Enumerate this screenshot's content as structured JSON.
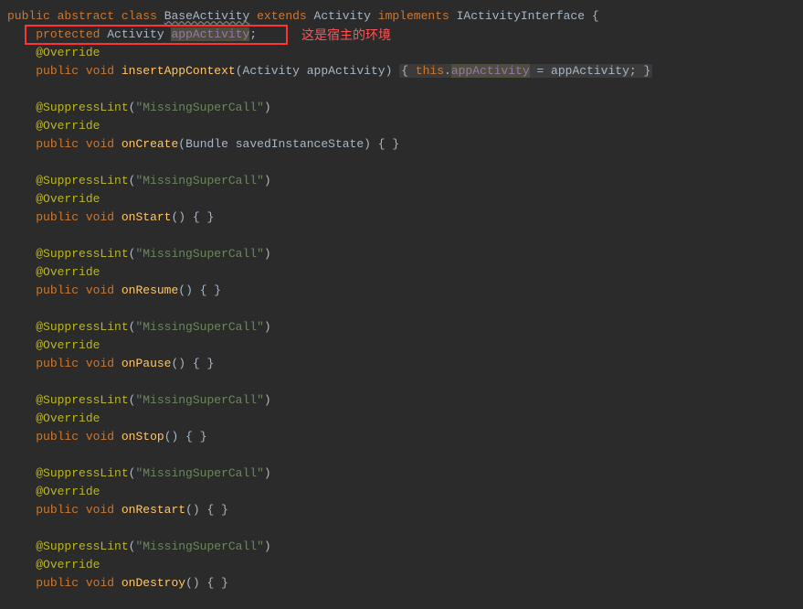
{
  "annotation_text": "这是宿主的环境",
  "code": {
    "line1": {
      "kw1": "public",
      "kw2": "abstract",
      "kw3": "class",
      "cls1": "BaseActivity",
      "kw4": "extends",
      "cls2": "Activity",
      "kw5": "implements",
      "cls3": "IActivityInterface",
      "brace": " {"
    },
    "line2": {
      "kw1": "protected",
      "cls": "Activity",
      "field": "appActivity",
      "semi": ";"
    },
    "line3": {
      "ann": "@Override"
    },
    "line4": {
      "kw1": "public",
      "kw2": "void",
      "method": "insertAppContext",
      "param_type": "Activity",
      "param_name": "appActivity",
      "body_open": "{ ",
      "this_kw": "this",
      "dot": ".",
      "field": "appActivity",
      "assign": " = appActivity; ",
      "body_close": "}"
    },
    "suppress": {
      "ann": "@SuppressLint",
      "paren_open": "(",
      "string": "\"MissingSuperCall\"",
      "paren_close": ")"
    },
    "override": {
      "ann": "@Override"
    },
    "onCreate": {
      "kw1": "public",
      "kw2": "void",
      "method": "onCreate",
      "param_type": "Bundle",
      "param_name": "savedInstanceState",
      "body": ") { }"
    },
    "onStart": {
      "kw1": "public",
      "kw2": "void",
      "method": "onStart",
      "body": "() { }"
    },
    "onResume": {
      "kw1": "public",
      "kw2": "void",
      "method": "onResume",
      "body": "() { }"
    },
    "onPause": {
      "kw1": "public",
      "kw2": "void",
      "method": "onPause",
      "body": "() { }"
    },
    "onStop": {
      "kw1": "public",
      "kw2": "void",
      "method": "onStop",
      "body": "() { }"
    },
    "onRestart": {
      "kw1": "public",
      "kw2": "void",
      "method": "onRestart",
      "body": "() { }"
    },
    "onDestroy": {
      "kw1": "public",
      "kw2": "void",
      "method": "onDestroy",
      "body": "() { }"
    }
  }
}
